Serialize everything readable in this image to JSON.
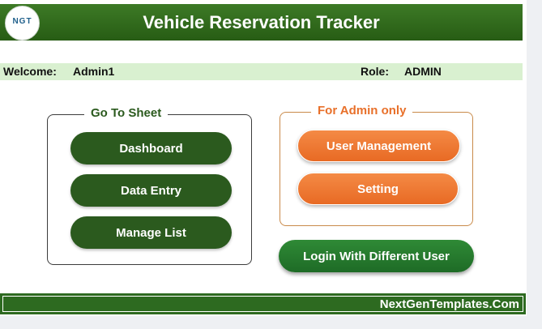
{
  "header": {
    "title": "Vehicle Reservation Tracker",
    "logo_text": "NGT",
    "logo_icon": "ngt-logo"
  },
  "user_bar": {
    "welcome_label": "Welcome:",
    "username": "Admin1",
    "role_label": "Role:",
    "role": "ADMIN"
  },
  "goto_sheet": {
    "title": "Go To Sheet",
    "buttons": [
      "Dashboard",
      "Data Entry",
      "Manage List"
    ]
  },
  "admin_only": {
    "title": "For Admin only",
    "buttons": [
      "User Management",
      "Setting"
    ]
  },
  "login_button": "Login With Different User",
  "footer": {
    "text": "NextGenTemplates.Com"
  },
  "colors": {
    "header_green": "#2d6a1e",
    "button_green": "#2b5a1e",
    "accent_orange": "#ec7530",
    "welcome_bg": "#d9f0d0"
  }
}
